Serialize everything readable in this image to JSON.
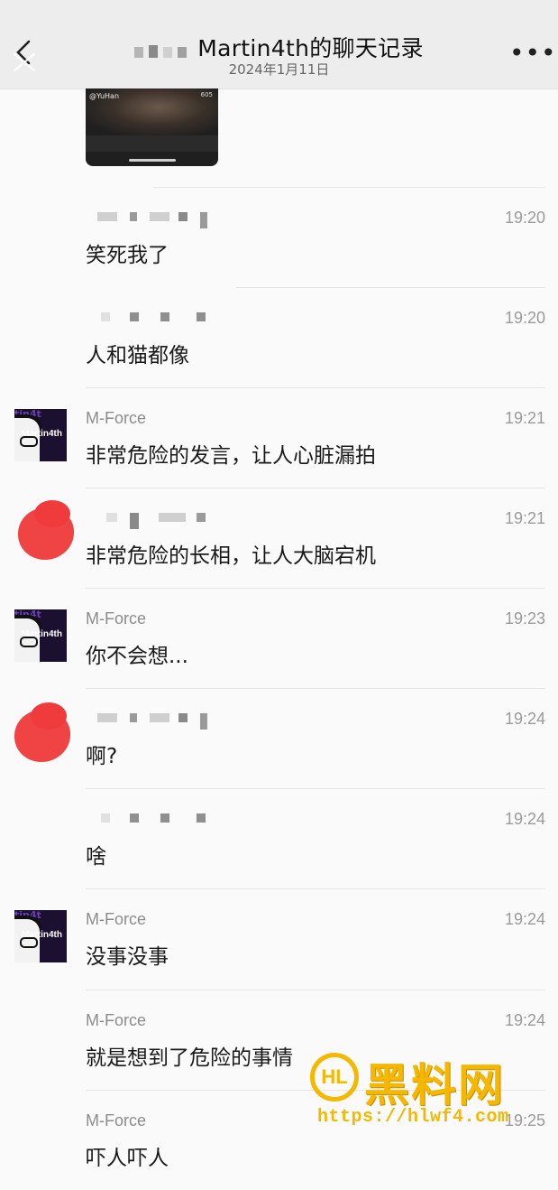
{
  "header": {
    "title": "Martin4th的聊天记录",
    "date": "2024年1月11日",
    "back_icon": "back-chevron-icon",
    "more_icon": "more-dots-icon"
  },
  "media_card": {
    "handle": "@YuHan",
    "count": "605"
  },
  "messages": [
    {
      "sender": "",
      "time": "19:20",
      "text": "笑死我了"
    },
    {
      "sender": "",
      "time": "19:20",
      "text": "人和猫都像"
    },
    {
      "sender": "M-Force",
      "time": "19:21",
      "text": "非常危险的发言，让人心脏漏拍"
    },
    {
      "sender": "",
      "time": "19:21",
      "text": "非常危险的长相，让人大脑宕机"
    },
    {
      "sender": "M-Force",
      "time": "19:23",
      "text": "你不会想..."
    },
    {
      "sender": "",
      "time": "19:24",
      "text": "啊?"
    },
    {
      "sender": "",
      "time": "19:24",
      "text": "啥"
    },
    {
      "sender": "M-Force",
      "time": "19:24",
      "text": "没事没事"
    },
    {
      "sender": "M-Force",
      "time": "19:24",
      "text": "就是想到了危险的事情"
    },
    {
      "sender": "M-Force",
      "time": "19:25",
      "text": "吓人吓人"
    }
  ],
  "avatar_label": "Martin4th",
  "watermark": {
    "logo": "HL",
    "title": "黑料网",
    "url": "https://hlwf4.com"
  },
  "colors": {
    "header_bg": "#ededed",
    "page_bg": "#fafafa",
    "watermark": "#f5b800",
    "red_avatar": "#f04343"
  }
}
